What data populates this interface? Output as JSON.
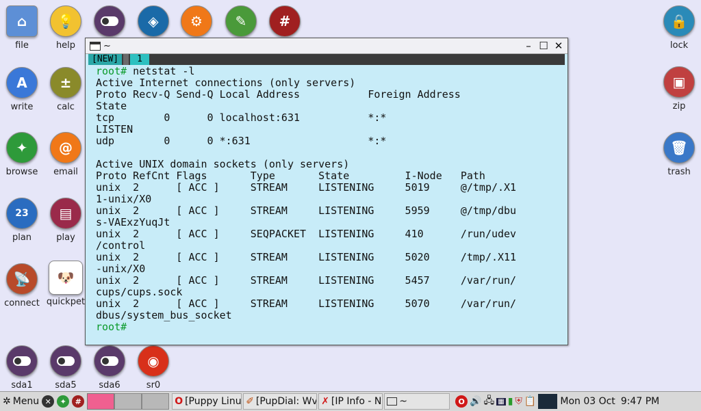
{
  "desktop": {
    "left_icons": [
      {
        "label": "file",
        "icon": "home-folder-icon",
        "color": "#5d8fd6"
      },
      {
        "label": "help",
        "icon": "lightbulb-icon",
        "color": "#f2c230"
      },
      {
        "label": "write",
        "icon": "abiword-icon",
        "color": "#3a78d8"
      },
      {
        "label": "calc",
        "icon": "calculator-icon",
        "color": "#8a8a2a"
      },
      {
        "label": "browse",
        "icon": "compass-icon",
        "color": "#2e9a3a"
      },
      {
        "label": "email",
        "icon": "at-sign-icon",
        "color": "#f07818"
      },
      {
        "label": "plan",
        "icon": "calendar-icon",
        "color": "#2a6cc0"
      },
      {
        "label": "play",
        "icon": "clapperboard-icon",
        "color": "#9a2a4a"
      },
      {
        "label": "connect",
        "icon": "satellite-dish-icon",
        "color": "#b84a2a"
      },
      {
        "label": "quickpet",
        "icon": "puppy-icon",
        "color": "#111111"
      }
    ],
    "top_icons": [
      {
        "icon": "toggle-icon",
        "color": "#5a3a6a"
      },
      {
        "icon": "dropbox-icon",
        "color": "#1a6aa8"
      },
      {
        "icon": "gear-icon",
        "color": "#f07818"
      },
      {
        "icon": "notepad-pencil-icon",
        "color": "#4a9a3a"
      },
      {
        "icon": "hash-terminal-icon",
        "color": "#a02020"
      }
    ],
    "right_icons": [
      {
        "label": "lock",
        "icon": "padlock-icon",
        "color": "#2a8ab8"
      },
      {
        "label": "zip",
        "icon": "archive-box-icon",
        "color": "#c04040"
      },
      {
        "label": "trash",
        "icon": "trash-can-icon",
        "color": "#3a78c8"
      }
    ],
    "drive_icons": [
      {
        "label": "sda1",
        "icon": "drive-toggle-icon",
        "color": "#5a3a6a"
      },
      {
        "label": "sda5",
        "icon": "drive-toggle-icon",
        "color": "#5a3a6a"
      },
      {
        "label": "sda6",
        "icon": "drive-toggle-icon",
        "color": "#5a3a6a"
      },
      {
        "label": "sr0",
        "icon": "optical-disc-icon",
        "color": "#d8301a"
      }
    ]
  },
  "terminal": {
    "title": "~",
    "tab_new": "[NEW]",
    "tab_1": "1",
    "lines": [
      {
        "prompt": "root#",
        "text": " netstat -l"
      },
      {
        "text": "Active Internet connections (only servers)"
      },
      {
        "text": "Proto Recv-Q Send-Q Local Address           Foreign Address"
      },
      {
        "text": "State"
      },
      {
        "text": "tcp        0      0 localhost:631           *:*"
      },
      {
        "text": "LISTEN"
      },
      {
        "text": "udp        0      0 *:631                   *:*"
      },
      {
        "text": ""
      },
      {
        "text": "Active UNIX domain sockets (only servers)"
      },
      {
        "text": "Proto RefCnt Flags       Type       State         I-Node   Path"
      },
      {
        "text": "unix  2      [ ACC ]     STREAM     LISTENING     5019     @/tmp/.X1"
      },
      {
        "text": "1-unix/X0"
      },
      {
        "text": "unix  2      [ ACC ]     STREAM     LISTENING     5959     @/tmp/dbu"
      },
      {
        "text": "s-VAExzYuqJt"
      },
      {
        "text": "unix  2      [ ACC ]     SEQPACKET  LISTENING     410      /run/udev"
      },
      {
        "text": "/control"
      },
      {
        "text": "unix  2      [ ACC ]     STREAM     LISTENING     5020     /tmp/.X11"
      },
      {
        "text": "-unix/X0"
      },
      {
        "text": "unix  2      [ ACC ]     STREAM     LISTENING     5457     /var/run/"
      },
      {
        "text": "cups/cups.sock"
      },
      {
        "text": "unix  2      [ ACC ]     STREAM     LISTENING     5070     /var/run/"
      },
      {
        "text": "dbus/system_bus_socket"
      },
      {
        "prompt": "root#",
        "text": ""
      }
    ]
  },
  "taskbar": {
    "menu_label": "Menu",
    "tasks": [
      {
        "label": "[Puppy Linu",
        "icon": "opera-icon"
      },
      {
        "label": "[PupDial: Wv",
        "icon": "dialup-icon"
      },
      {
        "label": "[IP Info - Ne",
        "icon": "ip-info-icon"
      },
      {
        "label": "~",
        "icon": "terminal-icon"
      }
    ],
    "date": "Mon 03 Oct",
    "time": "9:47 PM"
  }
}
